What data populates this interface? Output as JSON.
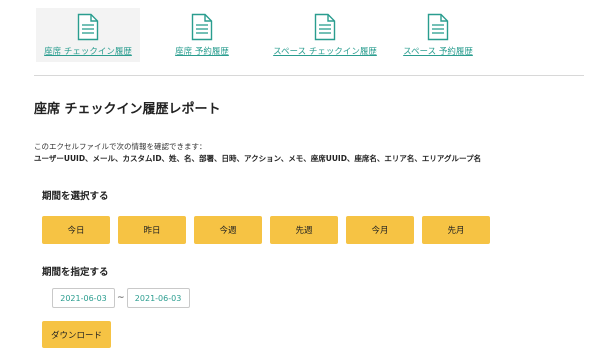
{
  "tabs": [
    {
      "label": "座席 チェックイン履歴",
      "icon": "document-icon",
      "active": true
    },
    {
      "label": "座席 予約履歴",
      "icon": "document-icon",
      "active": false
    },
    {
      "label": "スペース チェックイン履歴",
      "icon": "document-icon",
      "active": false
    },
    {
      "label": "スペース 予約履歴",
      "icon": "document-icon",
      "active": false
    }
  ],
  "title": "座席 チェックイン履歴レポート",
  "description": {
    "intro": "このエクセルファイルで次の情報を確認できます：",
    "fields": "ユーザーUUID、メール、カスタムID、姓、名、部署、日時、アクション、メモ、座席UUID、座席名、エリア名、エリアグループ名"
  },
  "select_period": {
    "label": "期間を選択する",
    "buttons": [
      "今日",
      "昨日",
      "今週",
      "先週",
      "今月",
      "先月"
    ]
  },
  "specify_period": {
    "label": "期間を指定する",
    "start": "2021-06-03",
    "separator": "~",
    "end": "2021-06-03"
  },
  "download_label": "ダウンロード",
  "colors": {
    "accent": "#f6c344",
    "link": "#2a9d8f",
    "active_tab_bg": "#f3f3f3"
  }
}
